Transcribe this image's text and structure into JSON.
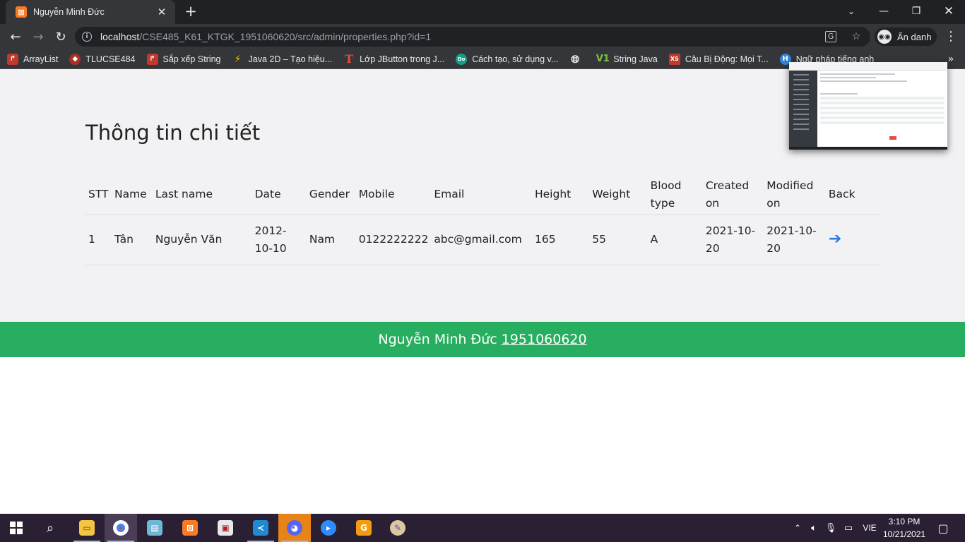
{
  "browser": {
    "tab_title": "Nguyễn Minh Đức",
    "tab_favicon": "xampp-icon",
    "url_host": "localhost",
    "url_path": "/CSE485_K61_KTGK_1951060620/src/admin/properties.php?id=1",
    "incognito_label": "Ẩn danh"
  },
  "bookmarks": [
    {
      "label": "ArrayList",
      "icon": "bookmark-arrow-icon",
      "color": "#c0392b"
    },
    {
      "label": "TLUCSE484",
      "icon": "bookmark-shield-icon",
      "color": "#a93226"
    },
    {
      "label": "Sắp xếp String",
      "icon": "bookmark-arrow-icon",
      "color": "#c0392b"
    },
    {
      "label": "Java 2D – Tạo hiệu...",
      "icon": "bookmark-bolt-icon",
      "color": "#f1c40f"
    },
    {
      "label": "Lớp JButton trong J...",
      "icon": "bookmark-t-icon",
      "color": "#e74c3c"
    },
    {
      "label": "Cách tạo, sử dụng v...",
      "icon": "bookmark-dofi-icon",
      "color": "#16a085"
    },
    {
      "label": "",
      "icon": "globe-icon",
      "color": "#e8eaed"
    },
    {
      "label": "String Java",
      "icon": "bookmark-v1-icon",
      "color": "#7dc242"
    },
    {
      "label": "Câu Bị Động: Mọi T...",
      "icon": "bookmark-xs-icon",
      "color": "#c0392b"
    },
    {
      "label": "Ngữ pháp tiếng anh",
      "icon": "bookmark-h-icon",
      "color": "#2e86de"
    }
  ],
  "page": {
    "heading": "Thông tin chi tiết",
    "columns": [
      "STT",
      "Name",
      "Last name",
      "Date",
      "Gender",
      "Mobile",
      "Email",
      "Height",
      "Weight",
      "Blood type",
      "Created on",
      "Modified on",
      "Back"
    ],
    "rows": [
      [
        "1",
        "Tân",
        "Nguyễn Văn",
        "2012-10-10",
        "Nam",
        "0122222222",
        "abc@gmail.com",
        "165",
        "55",
        "A",
        "2021-10-20",
        "2021-10-20"
      ]
    ],
    "accent_color": "#2a7ae2"
  },
  "footer": {
    "name": "Nguyễn Minh Đức",
    "student_id": "1951060620",
    "color": "#27ae60"
  },
  "taskbar": {
    "apps": [
      "file-explorer-icon",
      "chrome-icon",
      "notepad-icon",
      "xampp-icon",
      "filezilla-icon",
      "vscode-icon",
      "discord-icon",
      "zoom-icon",
      "foxit-icon",
      "paint-icon"
    ],
    "language": "VIE",
    "time": "3:10 PM",
    "date": "10/21/2021"
  }
}
